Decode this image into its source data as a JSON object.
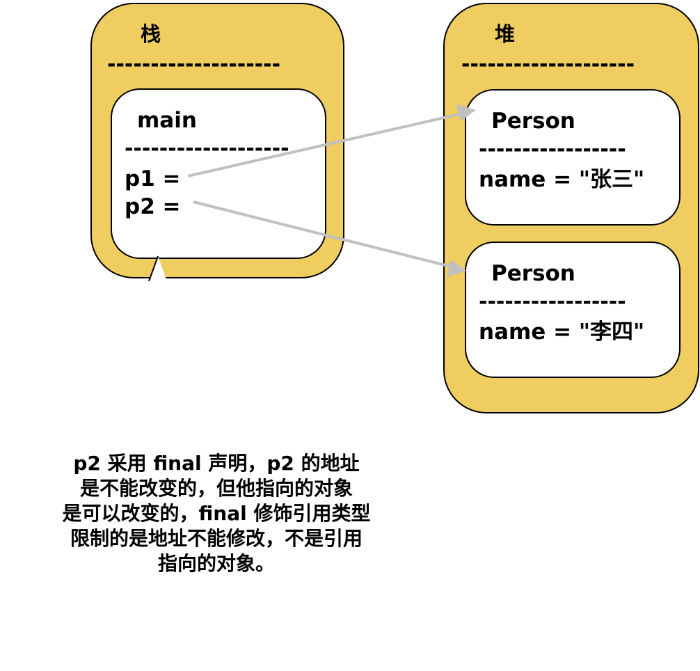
{
  "stack": {
    "title": "栈",
    "divider": "--------------------",
    "frame": {
      "name": "main",
      "divider": "-------------------",
      "vars": [
        "p1 =",
        "p2 ="
      ]
    }
  },
  "heap": {
    "title": "堆",
    "divider": "--------------------",
    "objects": [
      {
        "class_name": "Person",
        "divider": "-----------------",
        "field": "name = \"张三\""
      },
      {
        "class_name": "Person",
        "divider": "-----------------",
        "field": "name = \"李四\""
      }
    ]
  },
  "note": {
    "lines": [
      "p2 采用 final 声明，p2 的地址",
      "是不能改变的，但他指向的对象",
      "是可以改变的，final 修饰引用类型",
      "限制的是地址不能修改，不是引用",
      "指向的对象。"
    ]
  },
  "colors": {
    "panel_fill": "#f0cd60",
    "card_fill": "#ffffff",
    "outline": "#000000",
    "arrow": "#c0c0c0"
  }
}
